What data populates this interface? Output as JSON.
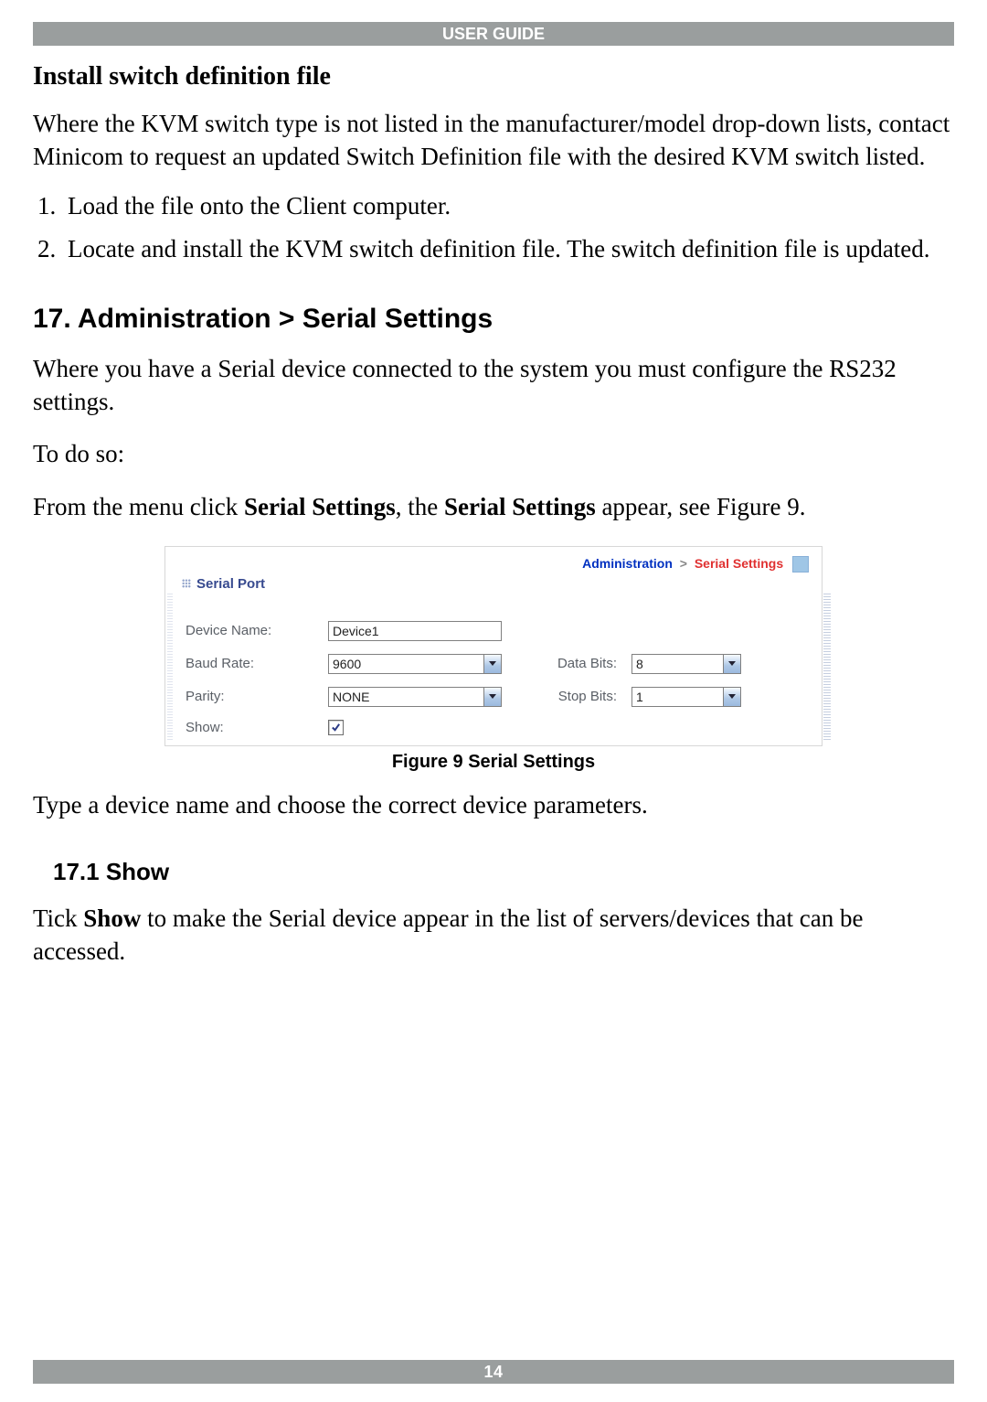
{
  "doc_header": "USER GUIDE",
  "page_number": "14",
  "heading_install": "Install switch definition file",
  "para_install": "Where the KVM switch type is not listed in the manufacturer/model drop-down lists, contact Minicom to request an updated Switch Definition file with the desired KVM switch listed.",
  "list_install": [
    "Load the file onto the Client computer.",
    "Locate and install the KVM switch definition file. The switch definition file is updated."
  ],
  "heading_section17": "17. Administration > Serial Settings",
  "para_section17": "Where you have a Serial device connected to the system you must configure the RS232 settings.",
  "para_todo": "To do so:",
  "para_from_menu_prefix": "From the menu click ",
  "bold_serial_settings": "Serial Settings",
  "para_from_menu_mid": ", the ",
  "para_from_menu_suffix": " appear, see Figure 9.",
  "figure_caption": "Figure 9 Serial Settings",
  "para_type_device": "Type a device name and choose the correct device parameters.",
  "heading_17_1": "17.1 Show",
  "para_17_1_prefix": "Tick ",
  "bold_show": "Show",
  "para_17_1_suffix": " to make the Serial device appear in the list of servers/devices that can be accessed.",
  "panel": {
    "breadcrumb_admin": "Administration",
    "breadcrumb_gt": ">",
    "breadcrumb_serial": "Serial Settings",
    "title": "Serial Port",
    "labels": {
      "device_name": "Device Name:",
      "baud_rate": "Baud Rate:",
      "parity": "Parity:",
      "show": "Show:",
      "data_bits": "Data Bits:",
      "stop_bits": "Stop Bits:"
    },
    "values": {
      "device_name": "Device1",
      "baud_rate": "9600",
      "parity": "NONE",
      "data_bits": "8",
      "stop_bits": "1",
      "show_checked": true
    }
  }
}
